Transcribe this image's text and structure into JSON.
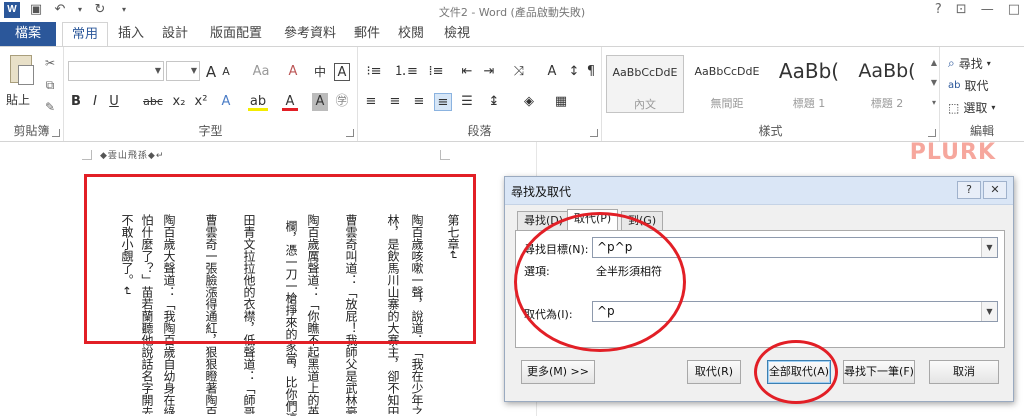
{
  "titlebar": {
    "app_logo": "W",
    "title": "文件2 - Word (產品啟動失敗)",
    "help": "?",
    "minimize": "—",
    "restore": "□"
  },
  "tabs": [
    "檔案",
    "常用",
    "插入",
    "設計",
    "版面配置",
    "參考資料",
    "郵件",
    "校閱",
    "檢視"
  ],
  "ribbon": {
    "clipboard": {
      "paste": "貼上",
      "label": "剪貼簿"
    },
    "font": {
      "label": "字型",
      "bold": "B",
      "italic": "I",
      "underline": "U",
      "strike": "abc",
      "subscript": "x₂",
      "superscript": "x²",
      "grow": "A",
      "shrink": "A",
      "case": "Aa",
      "clear": "A",
      "phonetic": "中",
      "border_char": "A",
      "font_color": "A",
      "shade": "A"
    },
    "paragraph": {
      "label": "段落"
    },
    "styles": {
      "label": "樣式",
      "items": [
        {
          "sample": "AaBbCcDdE",
          "name": "內文"
        },
        {
          "sample": "AaBbCcDdE",
          "name": "無間距"
        },
        {
          "sample": "AaBb(",
          "name": "標題 1"
        },
        {
          "sample": "AaBb(",
          "name": "標題 2"
        }
      ]
    },
    "editing": {
      "label": "編輯",
      "find": "尋找",
      "replace": "取代",
      "select": "選取"
    }
  },
  "document": {
    "header": "◆雲山飛孫◆↵",
    "watermark": "PLURK",
    "columns": [
      "第七章↵",
      "陶百歲咳嗽一聲，說道：「我在少年之時",
      "林，是飲馬川山寨的大寨主，卻不知田歸",
      "曹雲奇叫道：「放屁！我師父是武林豪傑",
      "陶百歲厲聲道：「你瞧不起黑道上的英雄",
      "欄，憑一刀一槍掙來的家當，比你們這",
      "田青文拉拉他的衣襟，低聲道：「師哥，你",
      "曹雲奇一張臉漲得通紅，狠狠瞪著陶百歲",
      "陶百歲大聲道：「我陶百歲自幼身在綠林",
      "怕什麼了？」苗若蘭聽他說話名字開去，於是",
      "不敢小覷了。↵"
    ]
  },
  "dialog": {
    "title": "尋找及取代",
    "help": "?",
    "close": "✕",
    "tabs": [
      "尋找(D)",
      "取代(P)",
      "到(G)"
    ],
    "find_label": "尋找目標(N):",
    "find_value": "^p^p",
    "options_label": "選項:",
    "options_value": "全半形須相符",
    "replace_label": "取代為(I):",
    "replace_value": "^p",
    "more": "更多(M) >>",
    "replace": "取代(R)",
    "replace_all": "全部取代(A)",
    "find_next": "尋找下一筆(F)",
    "cancel": "取消"
  },
  "colors": {
    "accent": "#2b579a",
    "annotation": "#e21f26"
  }
}
